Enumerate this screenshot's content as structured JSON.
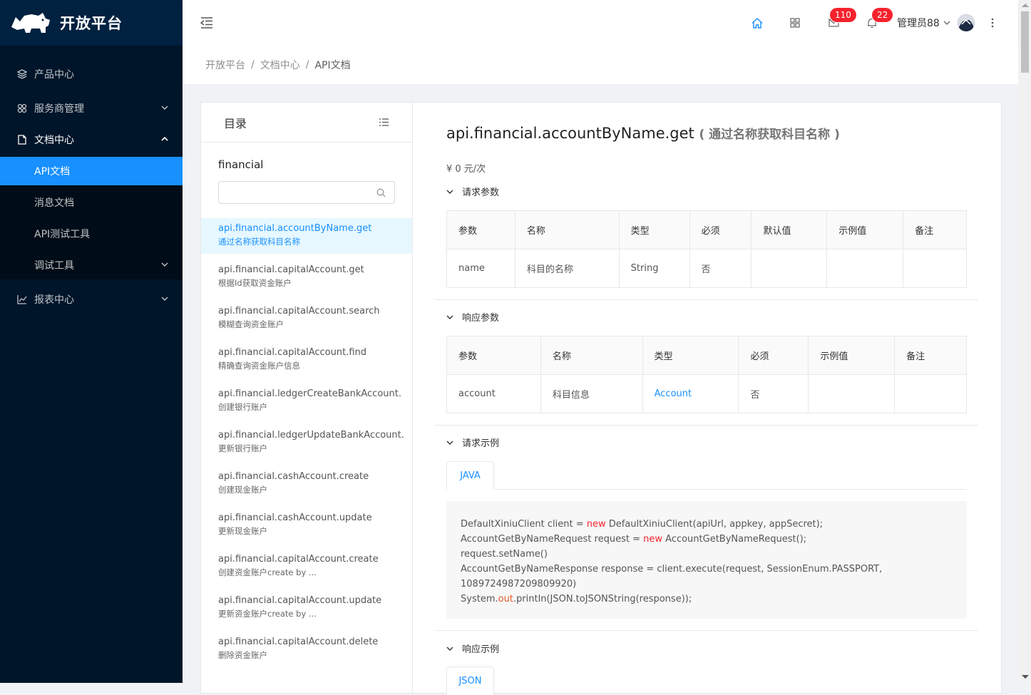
{
  "app": {
    "title": "开放平台"
  },
  "sidebar": {
    "items": [
      {
        "label": "产品中心",
        "icon": "layers-icon"
      },
      {
        "label": "服务商管理",
        "icon": "apps-icon"
      },
      {
        "label": "文档中心",
        "icon": "file-icon"
      },
      {
        "label": "报表中心",
        "icon": "line-chart-icon"
      }
    ],
    "docs_children": [
      "API文档",
      "消息文档",
      "API测试工具",
      "调试工具"
    ]
  },
  "header": {
    "mail_count": "110",
    "notice_count": "22",
    "user_name": "管理员88"
  },
  "breadcrumb": [
    "开放平台",
    "文档中心",
    "API文档"
  ],
  "catalog": {
    "title": "目录",
    "group": "financial",
    "search_placeholder": "",
    "items": [
      {
        "name": "api.financial.accountByName.get",
        "desc": "通过名称获取科目名称"
      },
      {
        "name": "api.financial.capitalAccount.get",
        "desc": "根据Id获取资金账户"
      },
      {
        "name": "api.financial.capitalAccount.search",
        "desc": "模糊查询资金账户"
      },
      {
        "name": "api.financial.capitalAccount.find",
        "desc": "精确查询资金账户信息"
      },
      {
        "name": "api.financial.ledgerCreateBankAccount.",
        "desc": "创建银行账户"
      },
      {
        "name": "api.financial.ledgerUpdateBankAccount.",
        "desc": "更新银行账户"
      },
      {
        "name": "api.financial.cashAccount.create",
        "desc": "创建现金账户"
      },
      {
        "name": "api.financial.cashAccount.update",
        "desc": "更新现金账户"
      },
      {
        "name": "api.financial.capitalAccount.create",
        "desc": "创建资金账户create by ..."
      },
      {
        "name": "api.financial.capitalAccount.update",
        "desc": "更新资金账户create by ..."
      },
      {
        "name": "api.financial.capitalAccount.delete",
        "desc": "删除资金账户"
      }
    ]
  },
  "doc": {
    "title": "api.financial.accountByName.get",
    "subtitle": "( 通过名称获取科目名称 )",
    "price": "¥ 0 元/次",
    "request_params": {
      "heading": "请求参数",
      "columns": [
        "参数",
        "名称",
        "类型",
        "必须",
        "默认值",
        "示例值",
        "备注"
      ],
      "rows": [
        [
          "name",
          "科目的名称",
          "String",
          "否",
          "",
          "",
          ""
        ]
      ]
    },
    "response_params": {
      "heading": "响应参数",
      "columns": [
        "参数",
        "名称",
        "类型",
        "必须",
        "示例值",
        "备注"
      ],
      "rows": [
        [
          "account",
          "科目信息",
          "Account",
          "否",
          "",
          ""
        ]
      ]
    },
    "request_example": {
      "heading": "请求示例",
      "tab": "JAVA",
      "lines": [
        {
          "a": "DefaultXiniuClient client = ",
          "k": "new",
          "b": " DefaultXiniuClient(apiUrl, appkey, appSecret);"
        },
        {
          "a": "AccountGetByNameRequest request = ",
          "k": "new",
          "b": " AccountGetByNameRequest();"
        },
        {
          "a": "request.setName()",
          "k": "",
          "b": ""
        },
        {
          "a": "AccountGetByNameResponse response = client.execute(request, SessionEnum.PASSPORT,",
          "k": "",
          "b": ""
        },
        {
          "a": "1089724987209809920)",
          "k": "",
          "b": ""
        },
        {
          "a": "System.",
          "o": "out",
          "b": ".println(JSON.toJSONString(response));"
        }
      ]
    },
    "response_example": {
      "heading": "响应示例",
      "tab": "JSON"
    }
  }
}
